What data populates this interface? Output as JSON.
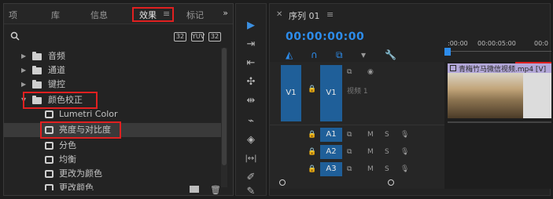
{
  "effects_panel": {
    "tabs": [
      {
        "label": "项"
      },
      {
        "label": "库"
      },
      {
        "label": "信息"
      },
      {
        "label": "效果",
        "active": true
      },
      {
        "label": "标记"
      }
    ],
    "active_tab_menu": "≡",
    "overflow": "»",
    "search_placeholder": "",
    "filter_buttons": [
      "32",
      "YUV",
      "32"
    ],
    "tree": [
      {
        "label": "音频",
        "type": "folder",
        "expanded": false
      },
      {
        "label": "通道",
        "type": "folder",
        "expanded": false
      },
      {
        "label": "键控",
        "type": "folder",
        "expanded": false
      },
      {
        "label": "颜色校正",
        "type": "folder",
        "expanded": true
      },
      {
        "label": "Lumetri Color",
        "type": "effect"
      },
      {
        "label": "亮度与对比度",
        "type": "effect",
        "selected": true
      },
      {
        "label": "分色",
        "type": "effect"
      },
      {
        "label": "均衡",
        "type": "effect"
      },
      {
        "label": "更改为颜色",
        "type": "effect"
      },
      {
        "label": "更改颜色",
        "type": "effect"
      }
    ]
  },
  "tools_panel": {
    "tools": [
      {
        "icon": "selection-arrow-icon",
        "glyph": "▶",
        "active": true
      },
      {
        "icon": "track-select-icon",
        "glyph": "⇥"
      },
      {
        "icon": "ripple-edit-icon",
        "glyph": "⇤"
      },
      {
        "icon": "rolling-edit-icon",
        "glyph": "✣"
      },
      {
        "icon": "rate-stretch-icon",
        "glyph": "⇹"
      },
      {
        "icon": "razor-icon",
        "glyph": "⌁"
      },
      {
        "icon": "slip-icon",
        "glyph": "◈"
      },
      {
        "icon": "slide-icon",
        "glyph": "|↔|"
      },
      {
        "icon": "pen-icon",
        "glyph": "✐"
      },
      {
        "icon": "hand-icon",
        "glyph": "✎"
      }
    ]
  },
  "timeline_panel": {
    "close_glyph": "✕",
    "title": "序列 01",
    "menu_glyph": "≡",
    "timecode": "00:00:00:00",
    "ruler_timecodes": [
      ":00:00",
      "00:00:05:00",
      "00:0"
    ],
    "tracks": [
      {
        "source": "V1",
        "target": "V1",
        "name": "视频 1",
        "kind": "video"
      },
      {
        "source": "",
        "target": "A1",
        "buttons": [
          "M",
          "S"
        ],
        "kind": "audio"
      },
      {
        "source": "",
        "target": "A2",
        "buttons": [
          "M",
          "S"
        ],
        "kind": "audio"
      },
      {
        "source": "",
        "target": "A3",
        "buttons": [
          "M",
          "S"
        ],
        "kind": "audio"
      }
    ],
    "clip": {
      "name": "青梅竹马微信视频.mp4 [V]",
      "color": "#b2a7d8"
    }
  }
}
